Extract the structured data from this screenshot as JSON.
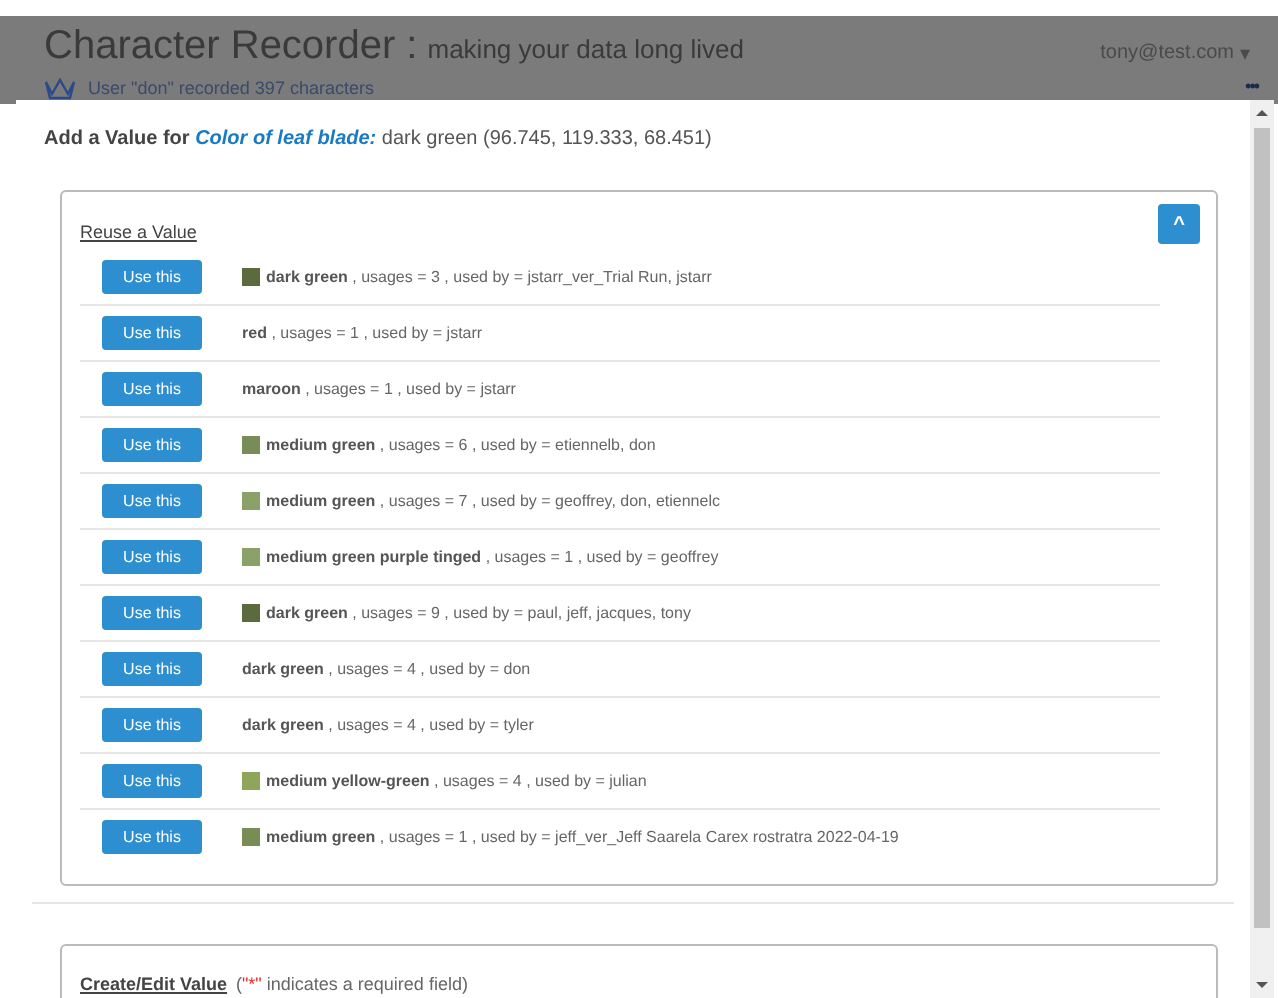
{
  "header": {
    "title": "Character Recorder :",
    "subtitle": "making your data long lived",
    "user_menu": "tony@test.com",
    "caret": "▾",
    "activity": "User \"don\" recorded 397 characters",
    "more": "•••"
  },
  "modal": {
    "heading_prefix": "Add a Value for",
    "character": "Color of leaf blade:",
    "current_value": "dark green (96.745, 119.333, 68.451)",
    "reuse": {
      "title": "Reuse a Value",
      "collapse": "^",
      "rows": [
        {
          "value": "dark green",
          "color": "#5b6b3e",
          "usages": ", usages = 3 , used by = jstarr_ver_Trial Run, jstarr",
          "button": "Use this"
        },
        {
          "value": "red",
          "usages": ", usages = 1 , used by = jstarr",
          "button": "Use this"
        },
        {
          "value": "maroon",
          "usages": ", usages = 1 , used by = jstarr",
          "button": "Use this"
        },
        {
          "value": "medium green",
          "color": "#778c57",
          "usages": ", usages = 6 , used by = etiennelb, don",
          "button": "Use this"
        },
        {
          "value": "medium green",
          "color": "#8aa26a",
          "usages": ", usages = 7 , used by = geoffrey, don, etiennelc",
          "button": "Use this"
        },
        {
          "value": "medium green purple tinged",
          "color": "#8aa26a",
          "usages": ", usages = 1 , used by = geoffrey",
          "button": "Use this"
        },
        {
          "value": "dark green",
          "color": "#5b6b3e",
          "usages": ", usages = 9 , used by = paul, jeff, jacques, tony",
          "button": "Use this"
        },
        {
          "value": "dark green",
          "usages": ", usages = 4 , used by = don",
          "button": "Use this"
        },
        {
          "value": "dark green",
          "usages": ", usages = 4 , used by = tyler",
          "button": "Use this"
        },
        {
          "value": "medium yellow-green",
          "color": "#8ea55a",
          "usages": ", usages = 4 , used by = julian",
          "button": "Use this"
        },
        {
          "value": "medium green",
          "color": "#788d55",
          "usages": ", usages = 1 , used by = jeff_ver_Jeff Saarela Carex rostratra 2022-04-19",
          "button": "Use this"
        }
      ]
    },
    "create": {
      "title": "Create/Edit Value",
      "note_open": "(",
      "note_mark": "\"*\"",
      "note_rest": " indicates a required field)"
    }
  }
}
